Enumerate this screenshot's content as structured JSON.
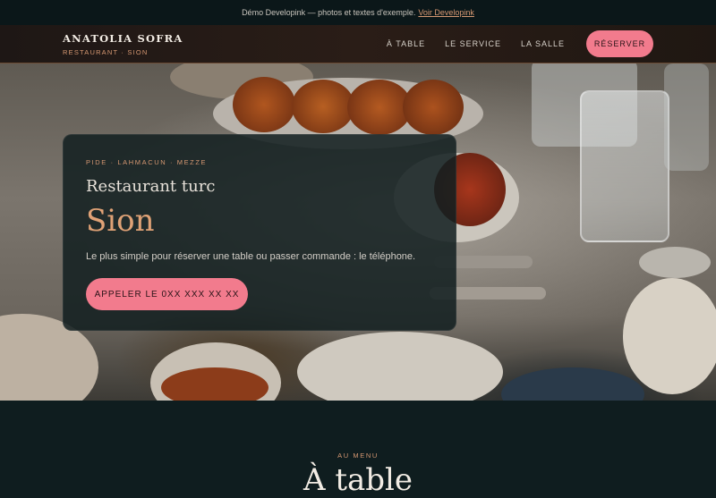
{
  "demo_bar": {
    "text": "Démo Developink — photos et textes d'exemple.",
    "link": "Voir Developink"
  },
  "header": {
    "brand_name": "ANATOLIA SOFRA",
    "brand_sub": "RESTAURANT · SION",
    "nav": [
      "À TABLE",
      "LE SERVICE",
      "LA SALLE"
    ],
    "cta": "RÉSERVER"
  },
  "hero": {
    "kicker": "PIDE · LAHMACUN · MEZZE",
    "title": "Restaurant turc",
    "city": "Sion",
    "text": "Le plus simple pour réserver une table ou passer commande : le téléphone.",
    "button": "APPELER LE 0XX XXX XX XX"
  },
  "menu": {
    "kicker": "AU MENU",
    "title": "À table"
  },
  "colors": {
    "accent": "#f27b8d",
    "gold": "#d69872",
    "bg": "#0f1d1f"
  }
}
